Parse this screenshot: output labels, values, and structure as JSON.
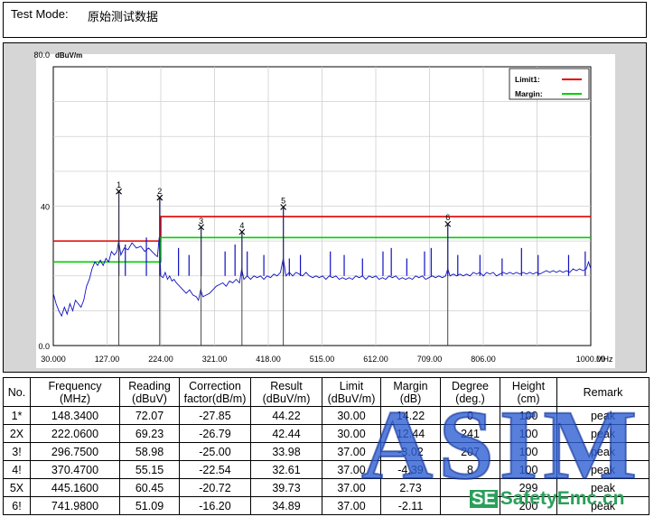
{
  "header": {
    "label": "Test Mode:",
    "value": "原始测试数据"
  },
  "chart_data": {
    "type": "line",
    "ylabel": "dBuV/m",
    "xunit": "MHz",
    "xlim": [
      30,
      1000
    ],
    "ylim": [
      0,
      80
    ],
    "x_ticks": [
      "30.000",
      "127.00",
      "224.00",
      "321.00",
      "418.00",
      "515.00",
      "612.00",
      "709.00",
      "806.00",
      "1000.00"
    ],
    "y_ticks": [
      "0.0",
      "40",
      "80.0"
    ],
    "grid": true,
    "legend_position": "top-right",
    "legend": [
      {
        "name": "Limit1:",
        "color": "#e00000"
      },
      {
        "name": "Margin:",
        "color": "#00d000"
      }
    ],
    "trace_color": "#1010c0",
    "limit_line": [
      [
        30,
        30
      ],
      [
        224,
        30
      ],
      [
        224,
        37
      ],
      [
        1000,
        37
      ]
    ],
    "margin_line": [
      [
        30,
        24
      ],
      [
        224,
        24
      ],
      [
        224,
        31
      ],
      [
        1000,
        31
      ]
    ],
    "markers": [
      {
        "label": "1",
        "freq": 148.34,
        "level": 44.22
      },
      {
        "label": "2",
        "freq": 222.06,
        "level": 42.44
      },
      {
        "label": "3",
        "freq": 296.75,
        "level": 33.98
      },
      {
        "label": "4",
        "freq": 370.47,
        "level": 32.61
      },
      {
        "label": "5",
        "freq": 445.16,
        "level": 39.73
      },
      {
        "label": "6",
        "freq": 741.98,
        "level": 34.89
      }
    ],
    "trace": [
      [
        30,
        15
      ],
      [
        35,
        12
      ],
      [
        40,
        10
      ],
      [
        45,
        8.5
      ],
      [
        50,
        11
      ],
      [
        55,
        9
      ],
      [
        60,
        12
      ],
      [
        65,
        10
      ],
      [
        70,
        13
      ],
      [
        75,
        12
      ],
      [
        80,
        11
      ],
      [
        85,
        13
      ],
      [
        90,
        17
      ],
      [
        95,
        19
      ],
      [
        100,
        22
      ],
      [
        105,
        24
      ],
      [
        110,
        23
      ],
      [
        115,
        24.5
      ],
      [
        120,
        23
      ],
      [
        125,
        25
      ],
      [
        130,
        24
      ],
      [
        135,
        27
      ],
      [
        140,
        26
      ],
      [
        145,
        27
      ],
      [
        148,
        30
      ],
      [
        152,
        26
      ],
      [
        158,
        28
      ],
      [
        165,
        27.5
      ],
      [
        172,
        29.5
      ],
      [
        180,
        28
      ],
      [
        188,
        28.5
      ],
      [
        195,
        27
      ],
      [
        202,
        28
      ],
      [
        208,
        27
      ],
      [
        214,
        26
      ],
      [
        218,
        25.5
      ],
      [
        221,
        31
      ],
      [
        224,
        20
      ],
      [
        228,
        19.5
      ],
      [
        232,
        21
      ],
      [
        236,
        19
      ],
      [
        240,
        20
      ],
      [
        244,
        18.5
      ],
      [
        248,
        19
      ],
      [
        252,
        18
      ],
      [
        258,
        17
      ],
      [
        264,
        16
      ],
      [
        270,
        15
      ],
      [
        276,
        16
      ],
      [
        282,
        14.5
      ],
      [
        288,
        14
      ],
      [
        292,
        13
      ],
      [
        296,
        16
      ],
      [
        300,
        14
      ],
      [
        306,
        14.5
      ],
      [
        312,
        15
      ],
      [
        318,
        16
      ],
      [
        324,
        17
      ],
      [
        330,
        17.5
      ],
      [
        336,
        18
      ],
      [
        342,
        17
      ],
      [
        348,
        18.5
      ],
      [
        354,
        18
      ],
      [
        360,
        19
      ],
      [
        366,
        18
      ],
      [
        370,
        22
      ],
      [
        374,
        19
      ],
      [
        380,
        20
      ],
      [
        386,
        19
      ],
      [
        392,
        20
      ],
      [
        398,
        19.5
      ],
      [
        404,
        20
      ],
      [
        410,
        19
      ],
      [
        416,
        20
      ],
      [
        422,
        19.5
      ],
      [
        428,
        20.5
      ],
      [
        434,
        20
      ],
      [
        440,
        21
      ],
      [
        445,
        25
      ],
      [
        450,
        20
      ],
      [
        456,
        21
      ],
      [
        462,
        20
      ],
      [
        468,
        21
      ],
      [
        474,
        20.5
      ],
      [
        480,
        20
      ],
      [
        486,
        21
      ],
      [
        492,
        20
      ],
      [
        498,
        19.5
      ],
      [
        504,
        20
      ],
      [
        510,
        19.5
      ],
      [
        516,
        20
      ],
      [
        522,
        19
      ],
      [
        528,
        20
      ],
      [
        534,
        19.5
      ],
      [
        540,
        20
      ],
      [
        546,
        19
      ],
      [
        552,
        19.5
      ],
      [
        558,
        19
      ],
      [
        564,
        19.5
      ],
      [
        570,
        19
      ],
      [
        576,
        20
      ],
      [
        582,
        19.5
      ],
      [
        588,
        20
      ],
      [
        594,
        19
      ],
      [
        600,
        20
      ],
      [
        606,
        19.5
      ],
      [
        612,
        20
      ],
      [
        618,
        19
      ],
      [
        624,
        19.5
      ],
      [
        630,
        19
      ],
      [
        636,
        20
      ],
      [
        642,
        19.5
      ],
      [
        648,
        20
      ],
      [
        654,
        19
      ],
      [
        660,
        19.5
      ],
      [
        666,
        19
      ],
      [
        672,
        19.5
      ],
      [
        678,
        19
      ],
      [
        684,
        20
      ],
      [
        690,
        19.5
      ],
      [
        696,
        20
      ],
      [
        702,
        19
      ],
      [
        708,
        19.5
      ],
      [
        714,
        20
      ],
      [
        720,
        19.5
      ],
      [
        726,
        20
      ],
      [
        732,
        19.5
      ],
      [
        738,
        20
      ],
      [
        742,
        22
      ],
      [
        746,
        20
      ],
      [
        752,
        20.5
      ],
      [
        758,
        20
      ],
      [
        764,
        20.5
      ],
      [
        770,
        20
      ],
      [
        776,
        20.5
      ],
      [
        782,
        20
      ],
      [
        788,
        21
      ],
      [
        794,
        20.5
      ],
      [
        800,
        21
      ],
      [
        806,
        20
      ],
      [
        812,
        21
      ],
      [
        818,
        20.5
      ],
      [
        824,
        21
      ],
      [
        830,
        20
      ],
      [
        836,
        20.5
      ],
      [
        842,
        21
      ],
      [
        848,
        20.5
      ],
      [
        854,
        21
      ],
      [
        860,
        20.5
      ],
      [
        866,
        21
      ],
      [
        872,
        20.5
      ],
      [
        878,
        21
      ],
      [
        884,
        20.5
      ],
      [
        890,
        21
      ],
      [
        896,
        20.5
      ],
      [
        902,
        21
      ],
      [
        908,
        20.5
      ],
      [
        914,
        21
      ],
      [
        920,
        21.5
      ],
      [
        926,
        21
      ],
      [
        932,
        21.5
      ],
      [
        938,
        21
      ],
      [
        944,
        21.5
      ],
      [
        950,
        21
      ],
      [
        956,
        21.5
      ],
      [
        962,
        21
      ],
      [
        968,
        22
      ],
      [
        974,
        21.5
      ],
      [
        980,
        22
      ],
      [
        986,
        21.5
      ],
      [
        992,
        22
      ],
      [
        996,
        24
      ],
      [
        1000,
        22
      ]
    ],
    "spikes": [
      [
        148.34,
        44.2
      ],
      [
        222.06,
        42.4
      ],
      [
        296.75,
        33.9
      ],
      [
        370.47,
        32.6
      ],
      [
        445.16,
        39.7
      ],
      [
        741.98,
        34.8
      ],
      [
        160,
        29
      ],
      [
        198,
        31
      ],
      [
        256,
        28
      ],
      [
        275,
        26
      ],
      [
        340,
        27
      ],
      [
        358,
        29
      ],
      [
        380,
        27
      ],
      [
        410,
        26
      ],
      [
        456,
        25
      ],
      [
        476,
        26
      ],
      [
        530,
        27
      ],
      [
        555,
        26
      ],
      [
        588,
        25
      ],
      [
        625,
        27
      ],
      [
        640,
        28
      ],
      [
        668,
        25
      ],
      [
        700,
        27
      ],
      [
        712,
        28
      ],
      [
        760,
        26
      ],
      [
        800,
        26
      ],
      [
        840,
        25
      ],
      [
        875,
        28
      ],
      [
        905,
        26
      ],
      [
        960,
        26
      ],
      [
        990,
        27
      ]
    ]
  },
  "table": {
    "headers": [
      "No.",
      "Frequency\n(MHz)",
      "Reading\n(dBuV)",
      "Correction\nfactor(dB/m)",
      "Result\n(dBuV/m)",
      "Limit\n(dBuV/m)",
      "Margin\n(dB)",
      "Degree\n(deg.)",
      "Height\n(cm)",
      "Remark"
    ],
    "rows": [
      [
        "1*",
        "148.3400",
        "72.07",
        "-27.85",
        "44.22",
        "30.00",
        "14.22",
        "0",
        "100",
        "peak"
      ],
      [
        "2X",
        "222.0600",
        "69.23",
        "-26.79",
        "42.44",
        "30.00",
        "12.44",
        "241",
        "100",
        "peak"
      ],
      [
        "3!",
        "296.7500",
        "58.98",
        "-25.00",
        "33.98",
        "37.00",
        "-3.02",
        "207",
        "100",
        "peak"
      ],
      [
        "4!",
        "370.4700",
        "55.15",
        "-22.54",
        "32.61",
        "37.00",
        "-4.39",
        "8",
        "100",
        "peak"
      ],
      [
        "5X",
        "445.1600",
        "60.45",
        "-20.72",
        "39.73",
        "37.00",
        "2.73",
        "",
        "299",
        "peak"
      ],
      [
        "6!",
        "741.9800",
        "51.09",
        "-16.20",
        "34.89",
        "37.00",
        "-2.11",
        "",
        "200",
        "peak"
      ]
    ]
  },
  "watermark": {
    "main": "ASIM",
    "se_box": "SE",
    "site": "SafetyEmc.cn"
  }
}
